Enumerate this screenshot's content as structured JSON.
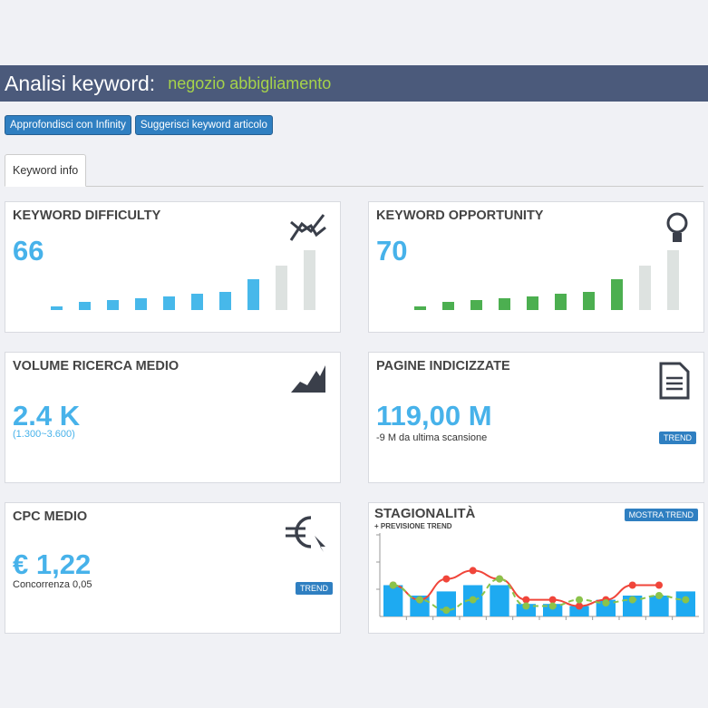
{
  "header": {
    "title": "Analisi keyword:",
    "keyword": "negozio abbigliamento"
  },
  "buttons": [
    "Approfondisci con Infinity",
    "Suggerisci keyword articolo"
  ],
  "tabs": [
    {
      "label": "Keyword info"
    }
  ],
  "difficulty": {
    "title": "KEYWORD DIFFICULTY",
    "value": "66",
    "level_bars": [
      0.06,
      0.13,
      0.17,
      0.19,
      0.22,
      0.27,
      0.31,
      0.52,
      0.75,
      1.0
    ],
    "active_bars": 8,
    "color": "#47b8ea"
  },
  "opportunity": {
    "title": "KEYWORD OPPORTUNITY",
    "value": "70",
    "level_bars": [
      0.06,
      0.13,
      0.17,
      0.19,
      0.22,
      0.27,
      0.31,
      0.52,
      0.75,
      1.0
    ],
    "active_bars": 8,
    "color": "#4caf50"
  },
  "volume": {
    "title": "VOLUME RICERCA MEDIO",
    "value": "2.4 K",
    "range": "(1.300~3.600)"
  },
  "pages": {
    "title": "PAGINE INDICIZZATE",
    "value": "119,00 M",
    "delta": "-9 M da ultima scansione",
    "button": "TREND"
  },
  "cpc": {
    "title": "CPC MEDIO",
    "value": "€ 1,22",
    "competition": "Concorrenza 0,05",
    "button": "TREND"
  },
  "chart_data": {
    "type": "bar",
    "title": "STAGIONALITÀ",
    "subtitle": "+ PREVISIONE TREND",
    "button": "MOSTRA TREND",
    "ylim": [
      0,
      4
    ],
    "series": [
      {
        "type": "bar",
        "values": [
          1.5,
          1.0,
          1.2,
          1.5,
          1.5,
          0.6,
          0.6,
          0.5,
          0.8,
          1.0,
          1.0,
          1.2
        ],
        "color": "#1eaaf1"
      },
      {
        "type": "line",
        "values": [
          1.5,
          0.8,
          1.8,
          2.2,
          1.8,
          0.8,
          0.8,
          0.5,
          0.8,
          1.5,
          1.5,
          null
        ],
        "color": "#f0453a"
      },
      {
        "type": "line-dashed",
        "values": [
          1.5,
          0.8,
          0.3,
          0.8,
          1.8,
          0.5,
          0.5,
          0.8,
          0.65,
          0.8,
          1.0,
          0.8
        ],
        "color": "#8bc34a"
      }
    ]
  }
}
